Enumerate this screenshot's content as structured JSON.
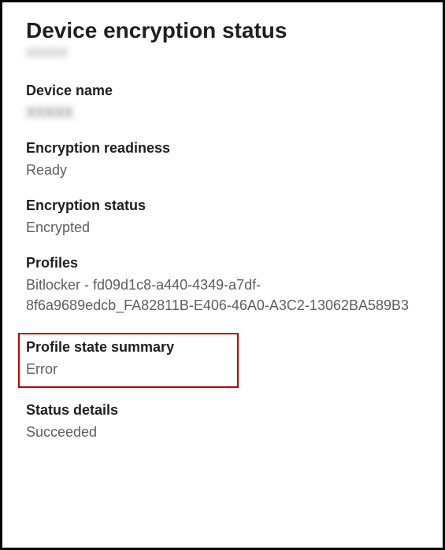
{
  "page": {
    "title": "Device encryption status",
    "subtitle_obscured": "XXXXX"
  },
  "fields": {
    "device_name": {
      "label": "Device name",
      "value_obscured": "XXXXX"
    },
    "encryption_readiness": {
      "label": "Encryption readiness",
      "value": "Ready"
    },
    "encryption_status": {
      "label": "Encryption status",
      "value": "Encrypted"
    },
    "profiles": {
      "label": "Profiles",
      "value": "Bitlocker - fd09d1c8-a440-4349-a7df-8f6a9689edcb_FA82811B-E406-46A0-A3C2-13062BA589B3"
    },
    "profile_state_summary": {
      "label": "Profile state summary",
      "value": "Error"
    },
    "status_details": {
      "label": "Status details",
      "value": "Succeeded"
    }
  }
}
